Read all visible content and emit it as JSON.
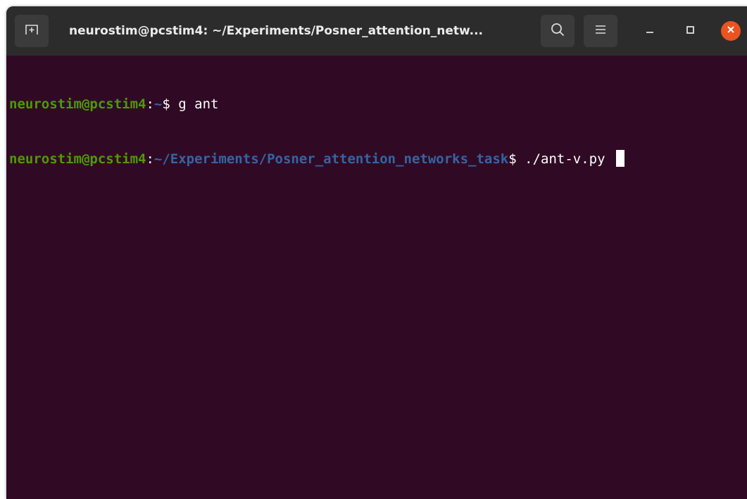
{
  "window": {
    "title": "neurostim@pcstim4: ~/Experiments/Posner_attention_netw...",
    "icons": {
      "new_tab": "new-tab-icon",
      "search": "search-icon",
      "menu": "hamburger-menu-icon",
      "minimize": "minimize-icon",
      "maximize": "maximize-icon",
      "close": "close-icon"
    }
  },
  "colors": {
    "terminal_bg": "#300a24",
    "user_host": "#4e9a06",
    "path": "#3465a4",
    "close_accent": "#e95420"
  },
  "terminal": {
    "lines": [
      {
        "user_host": "neurostim@pcstim4",
        "separator": ":",
        "path": "~",
        "prompt": "$ ",
        "command": "g ant"
      },
      {
        "user_host": "neurostim@pcstim4",
        "separator": ":",
        "path": "~/Experiments/Posner_attention_networks_task",
        "prompt": "$ ",
        "command": "./ant-v.py "
      }
    ]
  }
}
